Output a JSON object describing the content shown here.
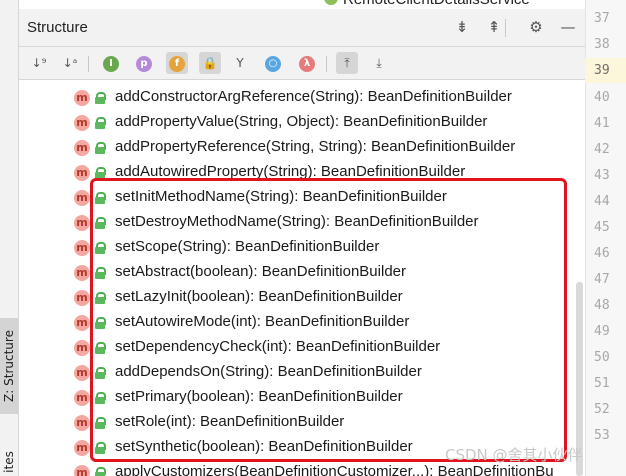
{
  "left_strip": {
    "structure_tab_label": "Z: Structure",
    "favorites_tab_label": "ites"
  },
  "top_context": {
    "class_name": "RemoteClientDetailsService"
  },
  "header": {
    "title": "Structure",
    "icons": [
      "expand-all-icon",
      "collapse-all-icon",
      "gear-icon",
      "minimize-icon"
    ]
  },
  "toolbar": {
    "buttons": [
      {
        "icon": "sort-by-visibility-icon",
        "glyph": "↓⁹"
      },
      {
        "icon": "sort-alphabetically-icon",
        "glyph": "↓ᵃ"
      },
      {
        "icon": "show-inherited-icon",
        "glyph": "I"
      },
      {
        "icon": "show-properties-icon",
        "glyph": "p"
      },
      {
        "icon": "show-fields-icon",
        "glyph": "f"
      },
      {
        "icon": "show-non-public-icon",
        "glyph": "🔒"
      },
      {
        "icon": "anonymous-classes-icon",
        "glyph": "Y"
      },
      {
        "icon": "show-lambdas-circle-icon",
        "glyph": "○"
      },
      {
        "icon": "show-lambdas-icon",
        "glyph": "λ"
      },
      {
        "icon": "autoscroll-to-source-icon",
        "glyph": "⤒"
      },
      {
        "icon": "autoscroll-from-source-icon",
        "glyph": "⤓"
      }
    ]
  },
  "tree": {
    "items": [
      {
        "label": "addConstructorArgReference(String): BeanDefinitionBuilder"
      },
      {
        "label": "addPropertyValue(String, Object): BeanDefinitionBuilder"
      },
      {
        "label": "addPropertyReference(String, String): BeanDefinitionBuilder"
      },
      {
        "label": "addAutowiredProperty(String): BeanDefinitionBuilder"
      },
      {
        "label": "setInitMethodName(String): BeanDefinitionBuilder"
      },
      {
        "label": "setDestroyMethodName(String): BeanDefinitionBuilder"
      },
      {
        "label": "setScope(String): BeanDefinitionBuilder"
      },
      {
        "label": "setAbstract(boolean): BeanDefinitionBuilder"
      },
      {
        "label": "setLazyInit(boolean): BeanDefinitionBuilder"
      },
      {
        "label": "setAutowireMode(int): BeanDefinitionBuilder"
      },
      {
        "label": "setDependencyCheck(int): BeanDefinitionBuilder"
      },
      {
        "label": "addDependsOn(String): BeanDefinitionBuilder"
      },
      {
        "label": "setPrimary(boolean): BeanDefinitionBuilder"
      },
      {
        "label": "setRole(int): BeanDefinitionBuilder"
      },
      {
        "label": "setSynthetic(boolean): BeanDefinitionBuilder"
      },
      {
        "label": "applyCustomizers(BeanDefinitionCustomizer...): BeanDefinitionBu"
      }
    ],
    "method_badge": "m"
  },
  "gutter": {
    "line_numbers": [
      "37",
      "38",
      "39",
      "40",
      "41",
      "42",
      "43",
      "44",
      "45",
      "46",
      "47",
      "48",
      "49",
      "50",
      "51",
      "52",
      "53"
    ],
    "current_line": "39"
  },
  "colors": {
    "highlight_border": "#e0141e",
    "method_icon_bg": "#f4a7a0",
    "lock_green": "#5cb85c"
  },
  "watermark": {
    "text": "CSDN @舍其小伙伴"
  }
}
